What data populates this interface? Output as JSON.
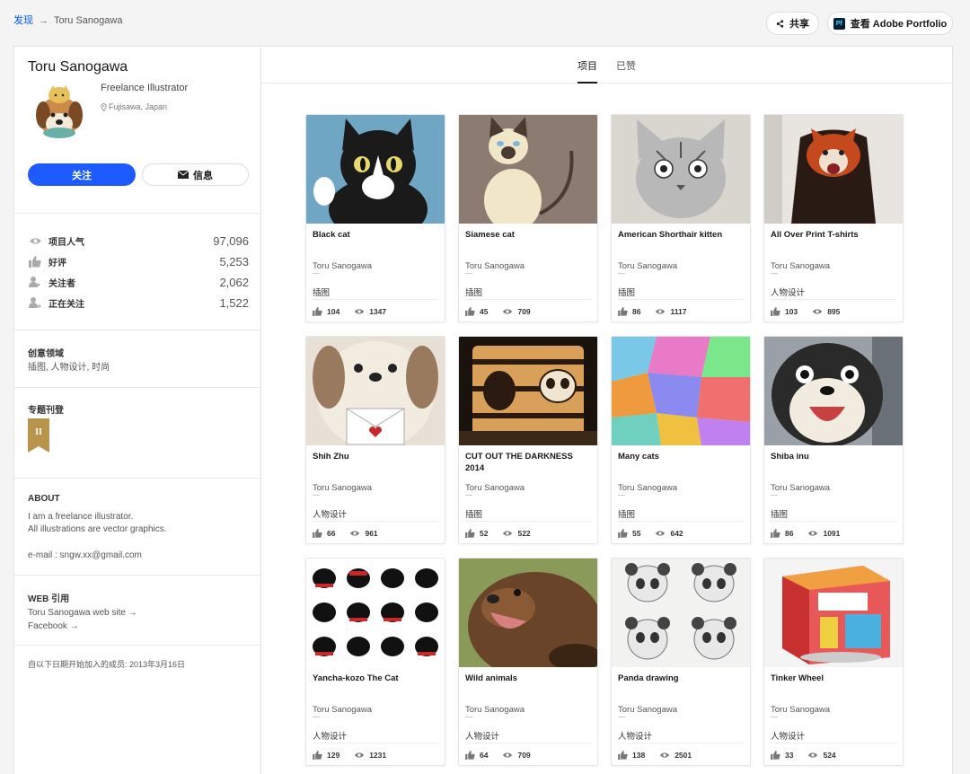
{
  "breadcrumb": {
    "discover": "发现",
    "arrow": "→",
    "current": "Toru Sanogawa"
  },
  "header": {
    "share_label": "共享",
    "portfolio_label": "查看 Adobe Portfolio",
    "portfolio_logo": "Pf"
  },
  "profile": {
    "name": "Toru Sanogawa",
    "occupation": "Freelance Illustrator",
    "location": "Fujisawa, Japan",
    "follow_label": "关注",
    "message_label": "信息"
  },
  "stats": [
    {
      "icon": "eye-icon",
      "label": "项目人气",
      "value": "97,096"
    },
    {
      "icon": "thumbs-up-icon",
      "label": "好评",
      "value": "5,253"
    },
    {
      "icon": "follower-icon",
      "label": "关注者",
      "value": "2,062"
    },
    {
      "icon": "following-icon",
      "label": "正在关注",
      "value": "1,522"
    }
  ],
  "creative_fields": {
    "title": "创意领域",
    "text": "插图, 人物设计, 时尚"
  },
  "featured": {
    "title": "专题刊登",
    "badge": "II"
  },
  "about": {
    "title": "ABOUT",
    "line1": "I am a freelance illustrator.",
    "line2": "All illustrations are vector graphics.",
    "email": "e-mail : sngw.xx@gmail.com"
  },
  "web": {
    "title": "WEB 引用",
    "link1": "Toru Sanogawa web site →",
    "link2": "Facebook →"
  },
  "member_since": "自以下日期开始加入的成员: 2013年3月16日",
  "tabs": {
    "projects": "项目",
    "appreciated": "已赞"
  },
  "colors": {
    "accent": "#1e5bff",
    "link": "#0057ff"
  },
  "projects": [
    {
      "title": "Black cat",
      "author": "Toru Sanogawa",
      "tag": "插图",
      "likes": "104",
      "views": "1347"
    },
    {
      "title": "Siamese cat",
      "author": "Toru Sanogawa",
      "tag": "插图",
      "likes": "45",
      "views": "709"
    },
    {
      "title": "American Shorthair kitten",
      "author": "Toru Sanogawa",
      "tag": "插图",
      "likes": "86",
      "views": "1117"
    },
    {
      "title": "All Over Print T-shirts",
      "author": "Toru Sanogawa",
      "tag": "人物设计",
      "likes": "103",
      "views": "895"
    },
    {
      "title": "Shih Zhu",
      "author": "Toru Sanogawa",
      "tag": "人物设计",
      "likes": "66",
      "views": "961"
    },
    {
      "title": "CUT OUT THE DARKNESS 2014",
      "author": "Toru Sanogawa",
      "tag": "插图",
      "likes": "52",
      "views": "522"
    },
    {
      "title": "Many cats",
      "author": "Toru Sanogawa",
      "tag": "插图",
      "likes": "55",
      "views": "642"
    },
    {
      "title": "Shiba inu",
      "author": "Toru Sanogawa",
      "tag": "插图",
      "likes": "86",
      "views": "1091"
    },
    {
      "title": "Yancha-kozo The Cat",
      "author": "Toru Sanogawa",
      "tag": "人物设计",
      "likes": "129",
      "views": "1231"
    },
    {
      "title": "Wild animals",
      "author": "Toru Sanogawa",
      "tag": "人物设计",
      "likes": "64",
      "views": "709"
    },
    {
      "title": "Panda drawing",
      "author": "Toru Sanogawa",
      "tag": "人物设计",
      "likes": "138",
      "views": "2501"
    },
    {
      "title": "Tinker Wheel",
      "author": "Toru Sanogawa",
      "tag": "人物设计",
      "likes": "33",
      "views": "524"
    }
  ]
}
